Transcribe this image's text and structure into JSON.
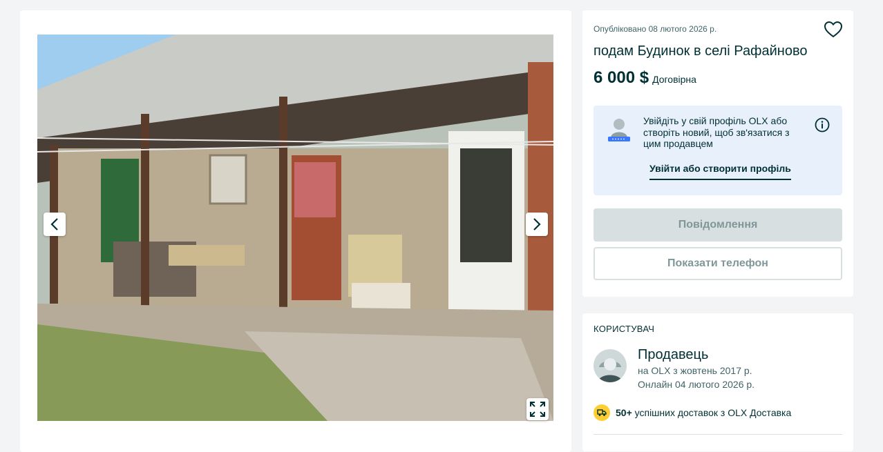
{
  "gallery": {
    "prev_icon": "chevron-left-icon",
    "next_icon": "chevron-right-icon",
    "fullscreen_icon": "expand-icon"
  },
  "listing": {
    "posted": "Опубліковано 08 лютого 2026 р.",
    "title": "подам Будинок в селі Рафайново",
    "price": "6 000 $",
    "negotiable": "Договірна",
    "favorite_icon": "heart-icon"
  },
  "login_prompt": {
    "text": "Увійдіть у свій профіль OLX або створіть новий, щоб зв'язатися з цим продавцем",
    "link": "Увійти або створити профіль",
    "info_icon": "info-icon"
  },
  "actions": {
    "message": "Повідомлення",
    "show_phone": "Показати телефон"
  },
  "user": {
    "heading": "КОРИСТУВАЧ",
    "name": "Продавець",
    "member_since": "на OLX з жовтень 2017 р.",
    "last_online": "Онлайн 04 лютого 2026 р.",
    "delivery_count": "50+",
    "delivery_text": "успішних доставок з OLX Доставка",
    "delivery_icon": "truck-icon"
  },
  "colors": {
    "text": "#002f34",
    "login_box_bg": "#e8f0fc",
    "disabled_button": "#d8dfe0",
    "delivery_badge": "#ffce32"
  }
}
